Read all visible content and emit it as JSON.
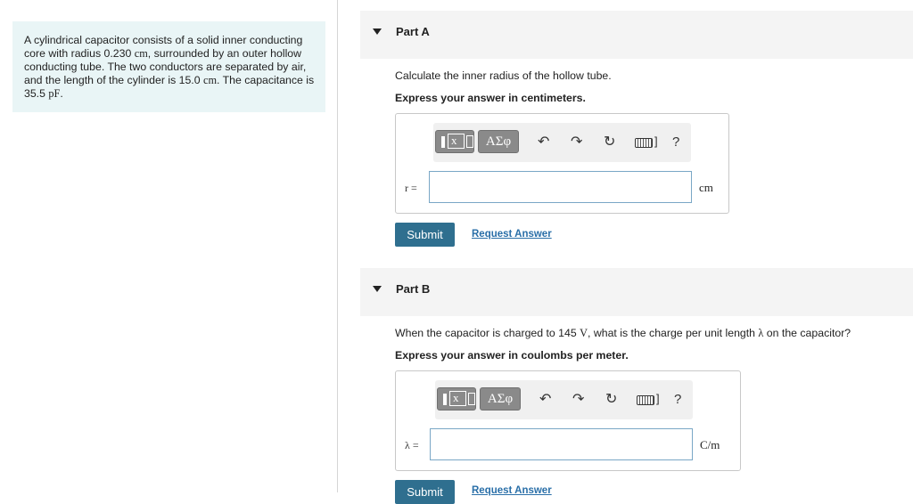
{
  "problem": {
    "t1": "A cylindrical capacitor consists of a solid inner conducting core with radius 0.230 ",
    "u1": "cm",
    "t2": ", surrounded by an outer hollow conducting tube. The two conductors are separated by air, and the length of the cylinder is 15.0 ",
    "u2": "cm",
    "t3": ". The capacitance is 35.5 ",
    "u3": "pF",
    "t4": "."
  },
  "toolbar": {
    "greek_label": "ΑΣφ",
    "radicand": "x",
    "undo_glyph": "↶",
    "redo_glyph": "↷",
    "reset_glyph": "↻",
    "keyboard_bracket": "]",
    "help_label": "?"
  },
  "partA": {
    "title": "Part A",
    "question": "Calculate the inner radius of the hollow tube.",
    "instruction": "Express your answer in centimeters.",
    "var_label": "r =",
    "unit": "cm",
    "input_value": "",
    "submit_label": "Submit",
    "request_label": "Request Answer"
  },
  "partB": {
    "title": "Part B",
    "q1": "When the capacitor is charged to 145 ",
    "qunit": "V",
    "q2": ", what is the charge per unit length ",
    "qsym": "λ",
    "q3": " on the capacitor?",
    "instruction": "Express your answer in coulombs per meter.",
    "var_label": "λ =",
    "unit": "C/m",
    "input_value": "",
    "submit_label": "Submit",
    "request_label": "Request Answer"
  }
}
